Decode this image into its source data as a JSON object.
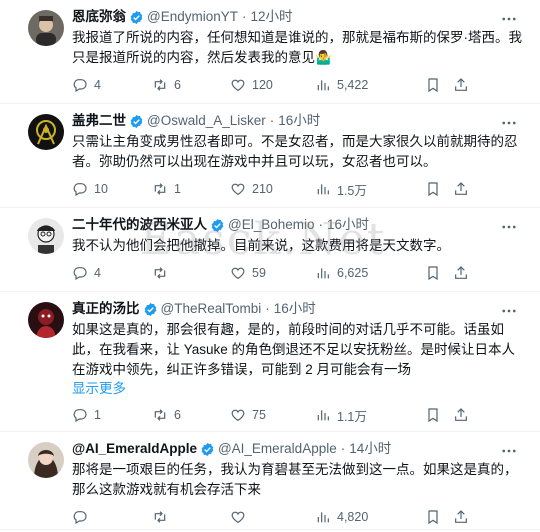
{
  "watermark": "Easck.Net",
  "tweets": [
    {
      "name": "恩底弥翁",
      "handle": "@EndymionYT",
      "time": "12小时",
      "text": "我报道了所说的内容，任何想知道是谁说的，那就是福布斯的保罗·塔西。我只是报道所说的内容，然后发表我的意见🤷‍♂️",
      "show_more": "",
      "replies": "4",
      "retweets": "6",
      "likes": "120",
      "views": "5,422"
    },
    {
      "name": "盖弗二世",
      "handle": "@Oswald_A_Lisker",
      "time": "16小时",
      "text": "只需让主角变成男性忍者即可。不是女忍者，而是大家很久以前就期待的忍者。弥助仍然可以出现在游戏中并且可以玩，女忍者也可以。",
      "show_more": "",
      "replies": "10",
      "retweets": "1",
      "likes": "210",
      "views": "1.5万"
    },
    {
      "name": "二十年代的波西米亚人",
      "handle": "@El_Bohemio",
      "time": "16小时",
      "text": "我不认为他们会把他撤掉。目前来说，这款费用将是天文数字。",
      "show_more": "",
      "replies": "4",
      "retweets": "",
      "likes": "59",
      "views": "6,625"
    },
    {
      "name": "真正的汤比",
      "handle": "@TheRealTombi",
      "time": "16小时",
      "text": "如果这是真的，那会很有趣，是的，前段时间的对话几乎不可能。话虽如此，在我看来，让 Yasuke 的角色倒退还不足以安抚粉丝。是时候让日本人在游戏中领先，纠正许多错误，可能到 2 月可能会有一场",
      "show_more": "显示更多",
      "replies": "1",
      "retweets": "6",
      "likes": "75",
      "views": "1.1万"
    },
    {
      "name": "@AI_EmeraldApple",
      "handle": "@AI_EmeraldApple",
      "time": "14小时",
      "text": "那将是一项艰巨的任务，我认为育碧甚至无法做到这一点。如果这是真的，那么这款游戏就有机会存活下来",
      "show_more": "",
      "replies": "",
      "retweets": "",
      "likes": "",
      "views": "4,820"
    }
  ],
  "colors": {
    "verified": "#1d9bf0",
    "muted": "#536471",
    "link": "#1d9bf0"
  }
}
